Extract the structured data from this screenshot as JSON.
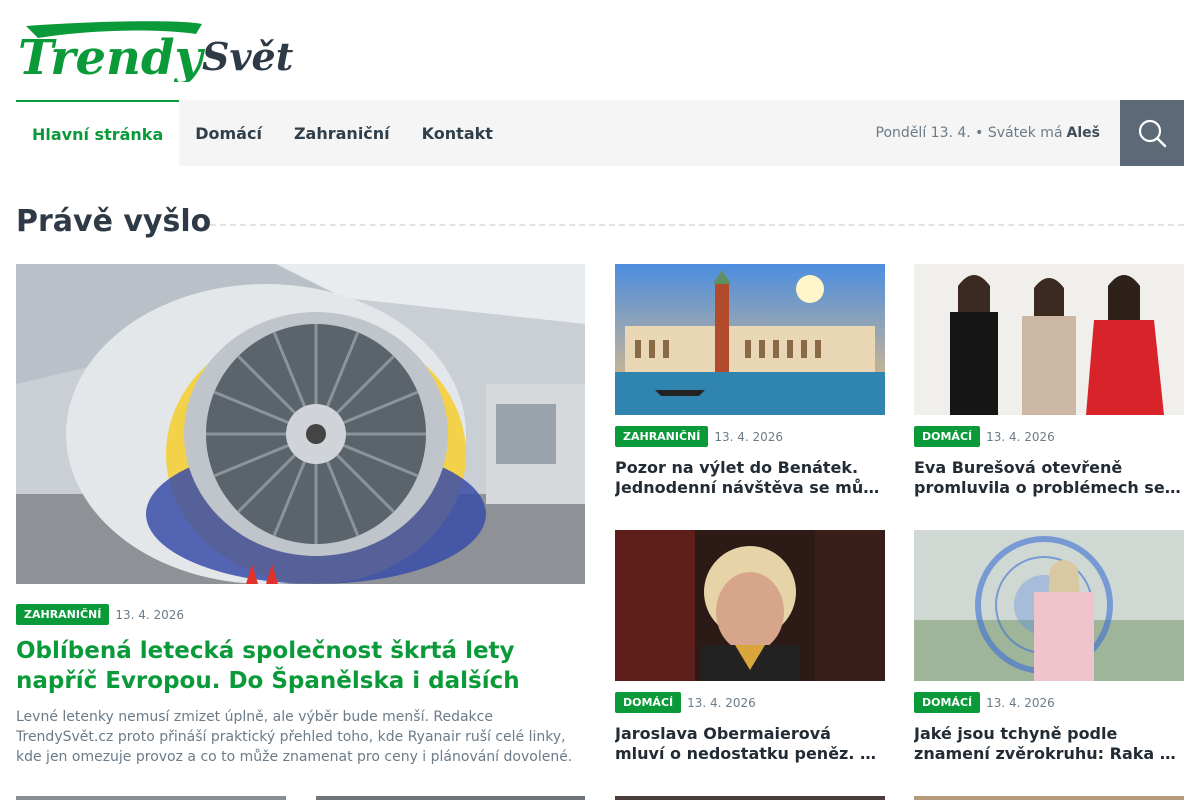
{
  "site": {
    "logo_text_1": "Trendy",
    "logo_text_2": "Svět",
    "brand_color": "#0b9a39"
  },
  "nav": {
    "items": [
      {
        "label": "Hlavní stránka",
        "active": true
      },
      {
        "label": "Domácí",
        "active": false
      },
      {
        "label": "Zahraniční",
        "active": false
      },
      {
        "label": "Kontakt",
        "active": false
      }
    ],
    "date_text": "Pondělí 13. 4. • Svátek má",
    "name_day": "Aleš",
    "search_icon": "search-icon"
  },
  "section": {
    "title": "Právě vyšlo"
  },
  "featured": {
    "category": "ZAHRANIČNÍ",
    "date": "13. 4. 2026",
    "title": "Oblíbená letecká společnost škrtá lety napříč Evropou. Do Španělska i dalších zemí bude…",
    "excerpt": "Levné letenky nemusí zmizet úplně, ale výběr bude menší. Redakce TrendySvět.cz proto přináší praktický přehled toho, kde Ryanair ruší celé linky, kde jen omezuje provoz a co to může znamenat pro ceny i plánování dovolené."
  },
  "articles": [
    {
      "category": "ZAHRANIČNÍ",
      "date": "13. 4. 2026",
      "title": "Pozor na výlet do Benátek. Jednodenní návštěva se může prodražit"
    },
    {
      "category": "DOMÁCÍ",
      "date": "13. 4. 2026",
      "title": "Eva Burešová otevřeně promluvila o problémech se spánkem"
    },
    {
      "category": "DOMÁCÍ",
      "date": "13. 4. 2026",
      "title": "Jaroslava Obermaierová mluví o nedostatku peněz. V Ulici si přivydělává"
    },
    {
      "category": "DOMÁCÍ",
      "date": "13. 4. 2026",
      "title": "Jaké jsou tchyně podle znamení zvěrokruhu: Raka si zamilujete, Blížence také"
    }
  ]
}
